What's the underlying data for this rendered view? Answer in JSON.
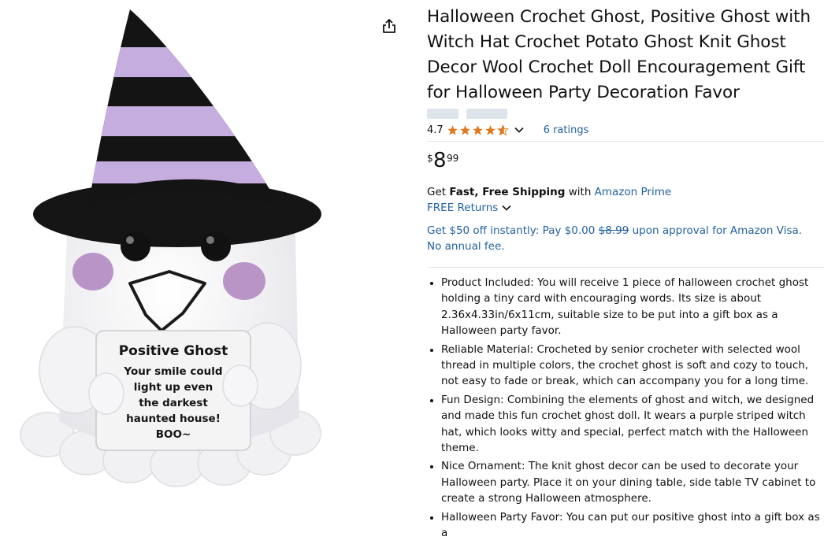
{
  "product": {
    "title": "Halloween Crochet Ghost, Positive Ghost with Witch Hat Crochet Potato Ghost Knit Ghost Decor Wool Crochet Doll Encouragement Gift for Halloween Party Decoration Favor",
    "title_lines": [
      "Halloween Crochet Ghost, Positive Ghost with",
      "Witch Hat Crochet Potato Ghost Knit Ghost",
      "Decor Wool Crochet Doll Encouragement Gift",
      "for Halloween Party Decoration Favor"
    ],
    "rating": "4.7",
    "stars": 4.7,
    "ratings_count": "6 ratings",
    "price": {
      "symbol": "$",
      "whole": "8",
      "fraction": "99"
    }
  },
  "image": {
    "card_title": "Positive Ghost",
    "card_lines": [
      "Your smile could",
      "light up even",
      "the darkest",
      "haunted house!",
      "BOO~"
    ]
  },
  "shipping": {
    "prefix": "Get ",
    "bold": "Fast, Free Shipping",
    "middle": " with ",
    "link": "Amazon Prime",
    "returns": "FREE Returns"
  },
  "promo": {
    "part1": "Get $50 off instantly: Pay $0.00 ",
    "strike": "$8.99",
    "part2": " upon approval for Amazon Visa. No annual fee."
  },
  "bullets": [
    "Product Included: You will receive 1 piece of halloween crochet ghost holding a tiny card with encouraging words. Its size is about 2.36x4.33in/6x11cm, suitable size to be put into a gift box as a Halloween party favor.",
    "Reliable Material: Crocheted by senior crocheter with selected wool thread in multiple colors, the crochet ghost is soft and cozy to touch, not easy to fade or break, which can accompany you for a long time.",
    "Fun Design: Combining the elements of ghost and witch, we designed and made this fun crochet ghost doll. It wears a purple striped witch hat, which looks witty and special, perfect match with the Halloween theme.",
    "Nice Ornament: The knit ghost decor can be used to decorate your Halloween party. Place it on your dining table, side table TV cabinet to create a strong Halloween atmosphere.",
    "Halloween Party Favor: You can put our positive ghost into a gift box as a"
  ],
  "colors": {
    "link": "#2162a1",
    "star": "#de7921",
    "text": "#0f1111"
  }
}
